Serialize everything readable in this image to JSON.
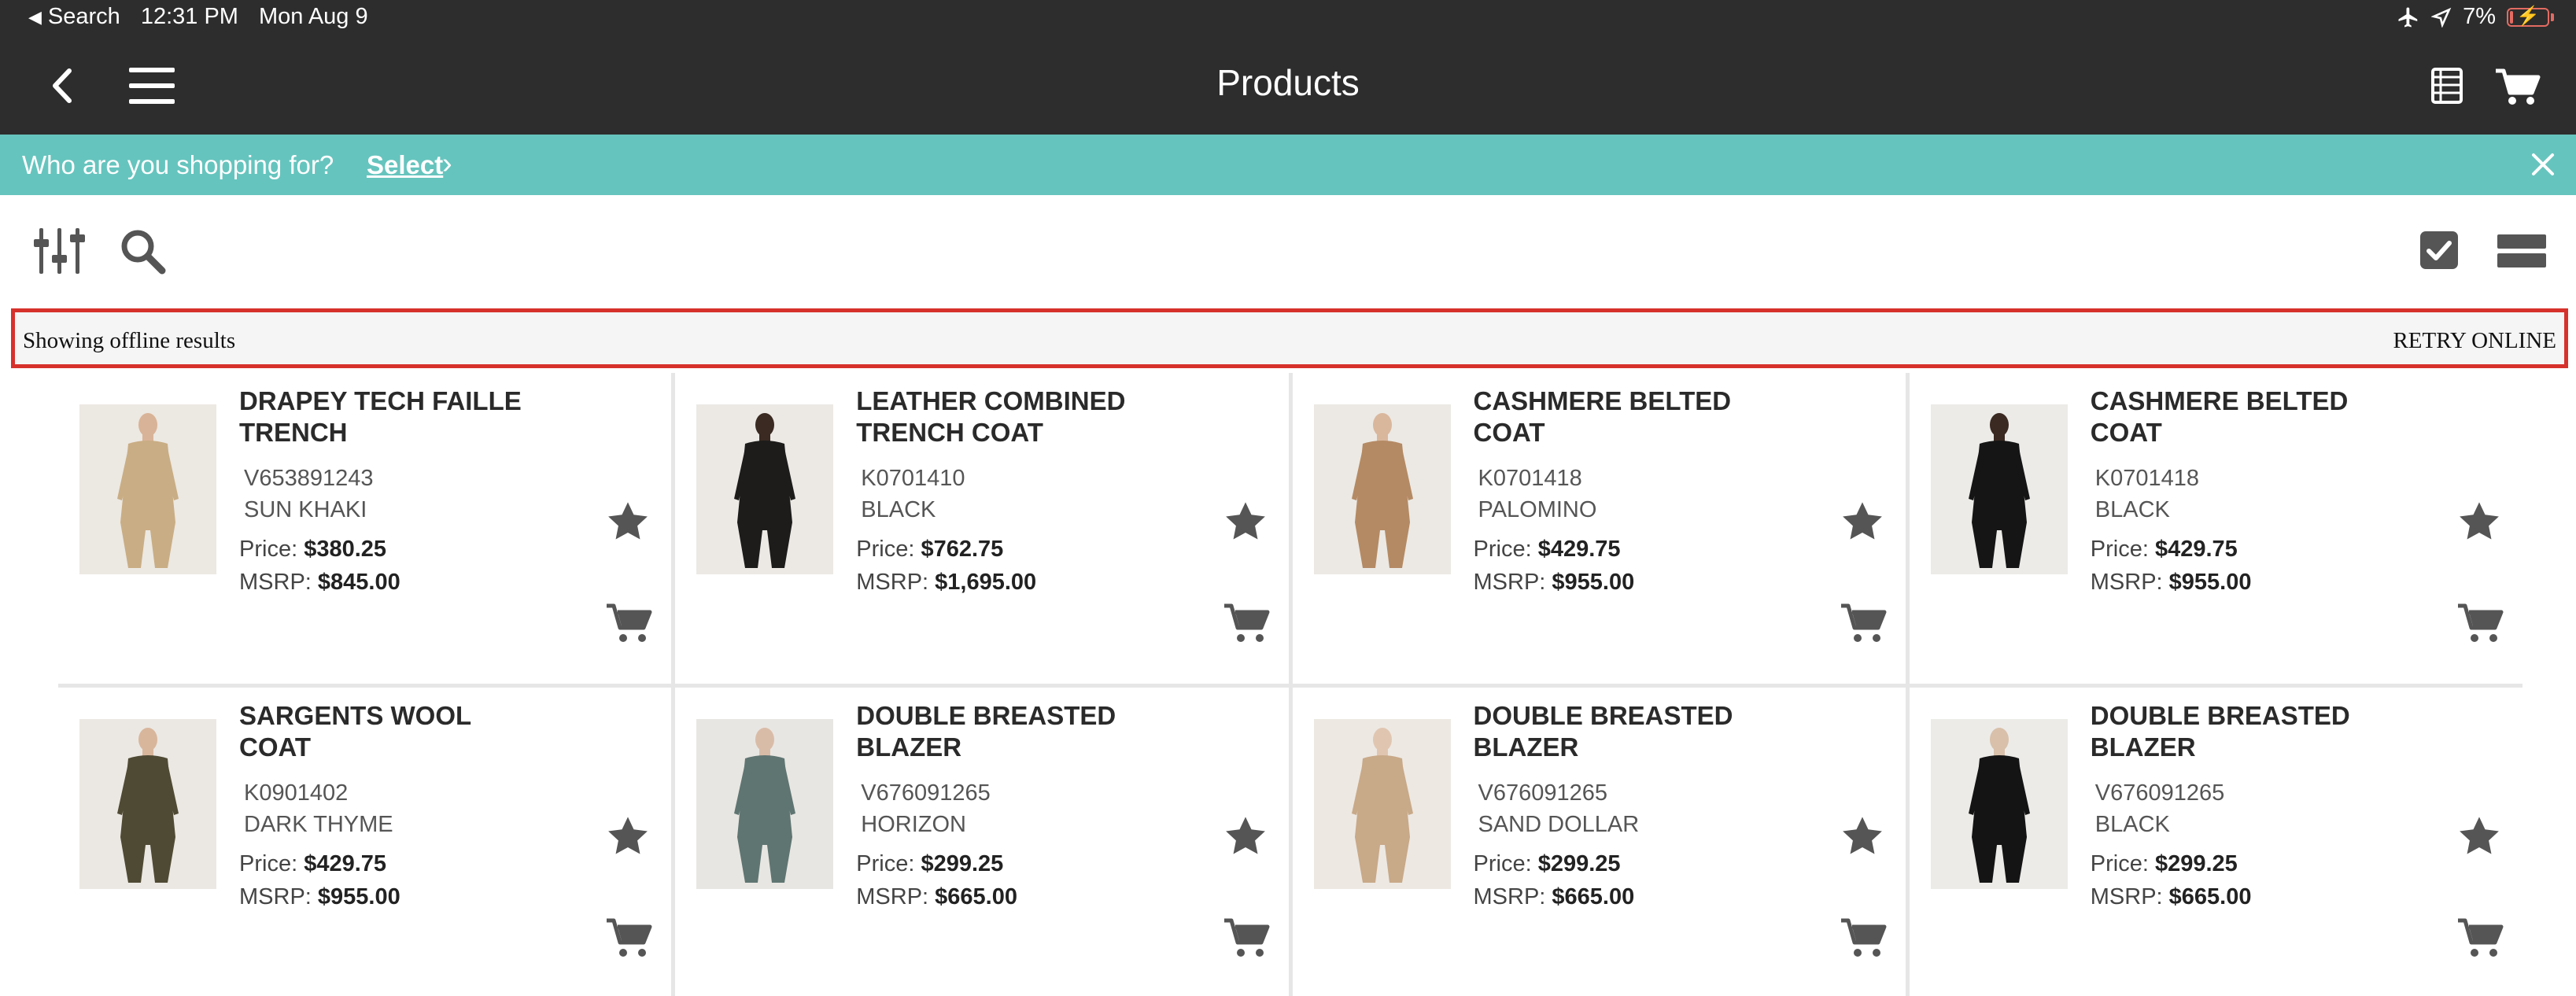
{
  "status_bar": {
    "back_app": "Search",
    "time": "12:31 PM",
    "date": "Mon Aug 9",
    "battery": "7%",
    "battery_level": 0.07
  },
  "nav": {
    "title": "Products"
  },
  "banner": {
    "question": "Who are you shopping for?",
    "select_label": "Select"
  },
  "offline": {
    "message": "Showing offline results",
    "retry_label": "RETRY ONLINE"
  },
  "products": [
    {
      "name": "DRAPEY TECH FAILLE TRENCH",
      "sku": "V653891243",
      "color": "SUN KHAKI",
      "price_label": "Price:",
      "price": "$380.25",
      "msrp_label": "MSRP:",
      "msrp": "$845.00",
      "thumb_bg": "#ece8e2",
      "garment": "#c9ad84",
      "skin": "#d9b397"
    },
    {
      "name": "LEATHER COMBINED TRENCH COAT",
      "sku": "K0701410",
      "color": "BLACK",
      "price_label": "Price:",
      "price": "$762.75",
      "msrp_label": "MSRP:",
      "msrp": "$1,695.00",
      "thumb_bg": "#ece9e5",
      "garment": "#1d1c1b",
      "skin": "#3a2a22"
    },
    {
      "name": "CASHMERE BELTED COAT",
      "sku": "K0701418",
      "color": "PALOMINO",
      "price_label": "Price:",
      "price": "$429.75",
      "msrp_label": "MSRP:",
      "msrp": "$955.00",
      "thumb_bg": "#ece9e4",
      "garment": "#b48a64",
      "skin": "#d9b79d"
    },
    {
      "name": "CASHMERE BELTED COAT",
      "sku": "K0701418",
      "color": "BLACK",
      "price_label": "Price:",
      "price": "$429.75",
      "msrp_label": "MSRP:",
      "msrp": "$955.00",
      "thumb_bg": "#ecebe8",
      "garment": "#151515",
      "skin": "#3b2a22"
    },
    {
      "name": "SARGENTS WOOL COAT",
      "sku": "K0901402",
      "color": "DARK THYME",
      "price_label": "Price:",
      "price": "$429.75",
      "msrp_label": "MSRP:",
      "msrp": "$955.00",
      "thumb_bg": "#ebe8e3",
      "garment": "#4f4a34",
      "skin": "#d8b69c"
    },
    {
      "name": "DOUBLE BREASTED BLAZER",
      "sku": "V676091265",
      "color": "HORIZON",
      "price_label": "Price:",
      "price": "$299.25",
      "msrp_label": "MSRP:",
      "msrp": "$665.00",
      "thumb_bg": "#e8e6e2",
      "garment": "#5f7572",
      "skin": "#d9bca8"
    },
    {
      "name": "DOUBLE BREASTED BLAZER",
      "sku": "V676091265",
      "color": "SAND DOLLAR",
      "price_label": "Price:",
      "price": "$299.25",
      "msrp_label": "MSRP:",
      "msrp": "$665.00",
      "thumb_bg": "#ede8e2",
      "garment": "#c8a988",
      "skin": "#e0c6b1"
    },
    {
      "name": "DOUBLE BREASTED BLAZER",
      "sku": "V676091265",
      "color": "BLACK",
      "price_label": "Price:",
      "price": "$299.25",
      "msrp_label": "MSRP:",
      "msrp": "$665.00",
      "thumb_bg": "#ecebe8",
      "garment": "#141414",
      "skin": "#d8c0aa"
    }
  ],
  "icons": {
    "status_left": "back-triangle-icon",
    "status_right": [
      "airplane-icon",
      "location-arrow-icon",
      "battery-charging-icon"
    ],
    "nav_left": [
      "back-chevron-icon",
      "hamburger-menu-icon"
    ],
    "nav_right": [
      "list-icon",
      "cart-icon"
    ],
    "toolbar_left": [
      "filter-sliders-icon",
      "search-icon"
    ],
    "toolbar_right": [
      "select-checkbox-icon",
      "list-view-icon"
    ],
    "card": [
      "star-icon",
      "add-to-cart-icon"
    ]
  },
  "colors": {
    "topbar": "#2d2d2d",
    "banner": "#66c4be",
    "offline_border": "#d7312c",
    "icon": "#555555"
  }
}
